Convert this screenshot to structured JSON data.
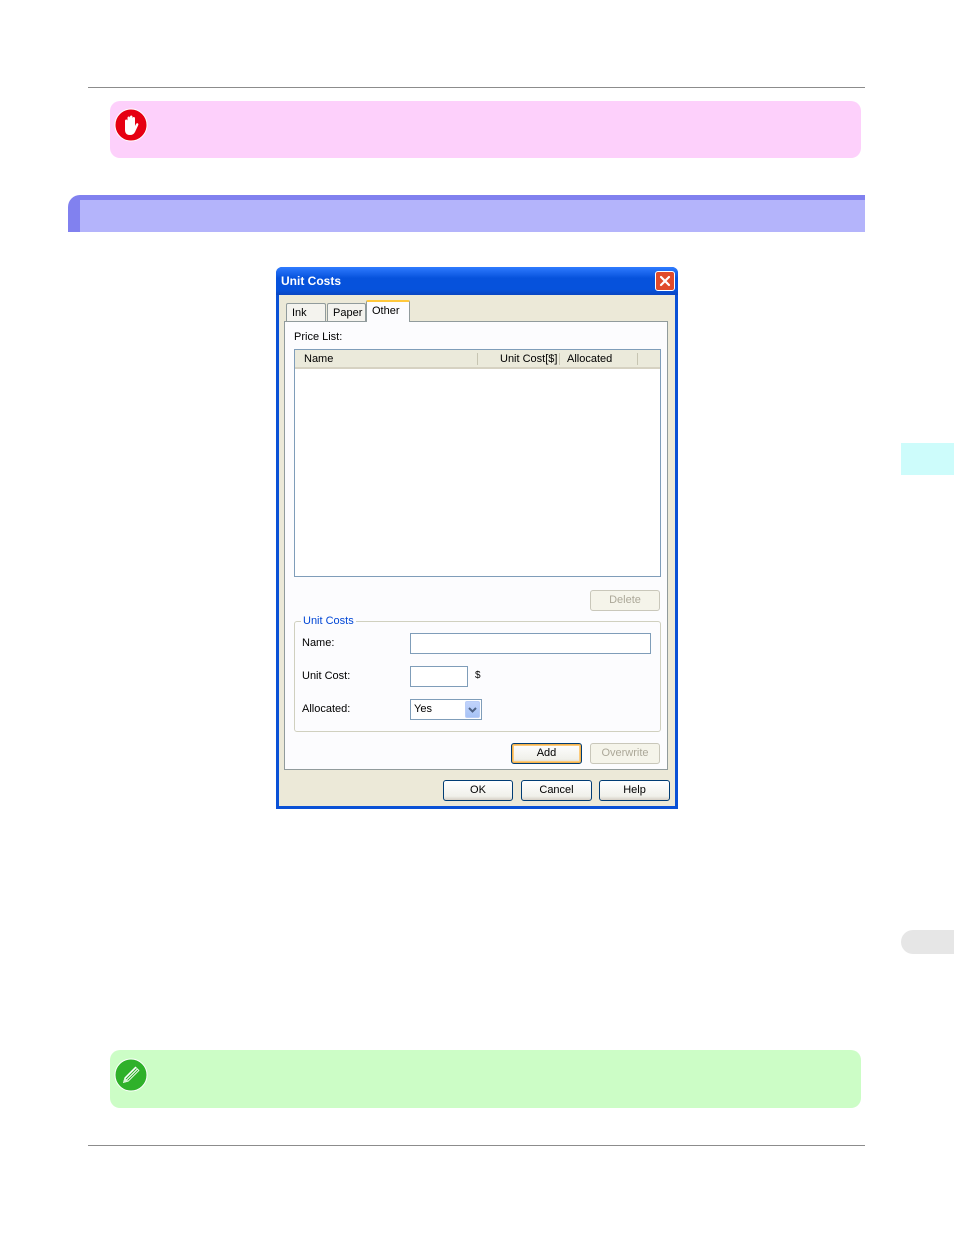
{
  "dialog": {
    "title": "Unit Costs",
    "tabs": [
      {
        "label": "Ink",
        "active": false
      },
      {
        "label": "Paper",
        "active": false
      },
      {
        "label": "Other",
        "active": true
      }
    ],
    "price_list_label": "Price List:",
    "columns": [
      "Name",
      "Unit Cost[$]",
      "Allocated"
    ],
    "rows": [],
    "delete_label": "Delete",
    "group_title": "Unit Costs",
    "name_label": "Name:",
    "name_value": "",
    "unit_cost_label": "Unit Cost:",
    "unit_cost_value": "",
    "currency_symbol": "$",
    "allocated_label": "Allocated:",
    "allocated_value": "Yes",
    "add_label": "Add",
    "overwrite_label": "Overwrite",
    "ok_label": "OK",
    "cancel_label": "Cancel",
    "help_label": "Help"
  },
  "colors": {
    "important_bg": "#fdd0fb",
    "note_bg": "#ccfdc6",
    "section_band": "#8181ef",
    "section_band_light": "#b4b4fb",
    "titlebar": "#0652dc"
  },
  "icons": {
    "important": "stop-hand-icon",
    "note": "pencil-note-icon",
    "close": "close-icon",
    "dropdown": "chevron-down-icon"
  }
}
